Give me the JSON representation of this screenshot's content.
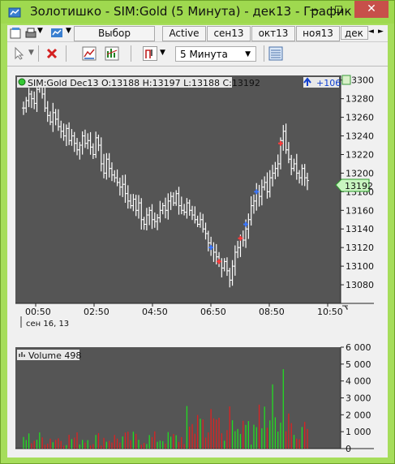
{
  "window": {
    "title": "Золотишко - SIM:Gold (5 Минута) - дек13 - График",
    "close_glyph": "✕",
    "minimize_glyph": "—",
    "maximize_glyph": "☐",
    "accent": "#9fd94f"
  },
  "toolbar": {
    "strategy_label": "Выбор Стратегии",
    "tabs": [
      "Active",
      "сен13",
      "окт13",
      "ноя13",
      "дек"
    ],
    "timeframe": "5 Минута",
    "scroll_left": "◄",
    "scroll_right": "►"
  },
  "price_panel": {
    "header": "SIM:Gold Dec13 O:13188 H:13197 L:13188 C:13192",
    "position_text": "+106",
    "last_price_label": "13192",
    "date_label": "сен 16, 13"
  },
  "volume_panel": {
    "header": "Volume 498"
  },
  "chart_data": [
    {
      "type": "ohlc",
      "title": "SIM:Gold Dec13",
      "x_tick_labels": [
        "00:50",
        "02:50",
        "04:50",
        "06:50",
        "08:50",
        "10:50"
      ],
      "y_tick_labels": [
        "13080",
        "13100",
        "13120",
        "13140",
        "13160",
        "13180",
        "13200",
        "13220",
        "13240",
        "13260",
        "13280",
        "13300"
      ],
      "ylim": [
        13060,
        13305
      ],
      "closes": [
        13270,
        13278,
        13285,
        13280,
        13275,
        13290,
        13295,
        13285,
        13270,
        13262,
        13255,
        13265,
        13258,
        13250,
        13245,
        13240,
        13248,
        13235,
        13240,
        13232,
        13225,
        13230,
        13240,
        13232,
        13235,
        13228,
        13220,
        13238,
        13230,
        13210,
        13200,
        13215,
        13205,
        13198,
        13195,
        13190,
        13185,
        13188,
        13178,
        13170,
        13165,
        13172,
        13160,
        13168,
        13150,
        13145,
        13155,
        13160,
        13150,
        13148,
        13152,
        13160,
        13165,
        13160,
        13170,
        13175,
        13168,
        13178,
        13165,
        13160,
        13158,
        13168,
        13160,
        13155,
        13150,
        13145,
        13150,
        13140,
        13135,
        13125,
        13120,
        13115,
        13110,
        13105,
        13098,
        13105,
        13095,
        13085,
        13100,
        13115,
        13120,
        13130,
        13128,
        13140,
        13150,
        13165,
        13170,
        13180,
        13175,
        13185,
        13190,
        13180,
        13195,
        13200,
        13205,
        13210,
        13235,
        13245,
        13225,
        13215,
        13205,
        13210,
        13200,
        13195,
        13205,
        13195,
        13192
      ],
      "buy_markers": [
        13120,
        13145,
        13180
      ],
      "sell_markers": [
        13105,
        13130,
        13232
      ]
    },
    {
      "type": "bar",
      "title": "Volume",
      "y_tick_labels": [
        "0",
        "1 000",
        "2 000",
        "3 000",
        "4 000",
        "5 000",
        "6 000"
      ],
      "ylim": [
        0,
        6000
      ]
    }
  ]
}
